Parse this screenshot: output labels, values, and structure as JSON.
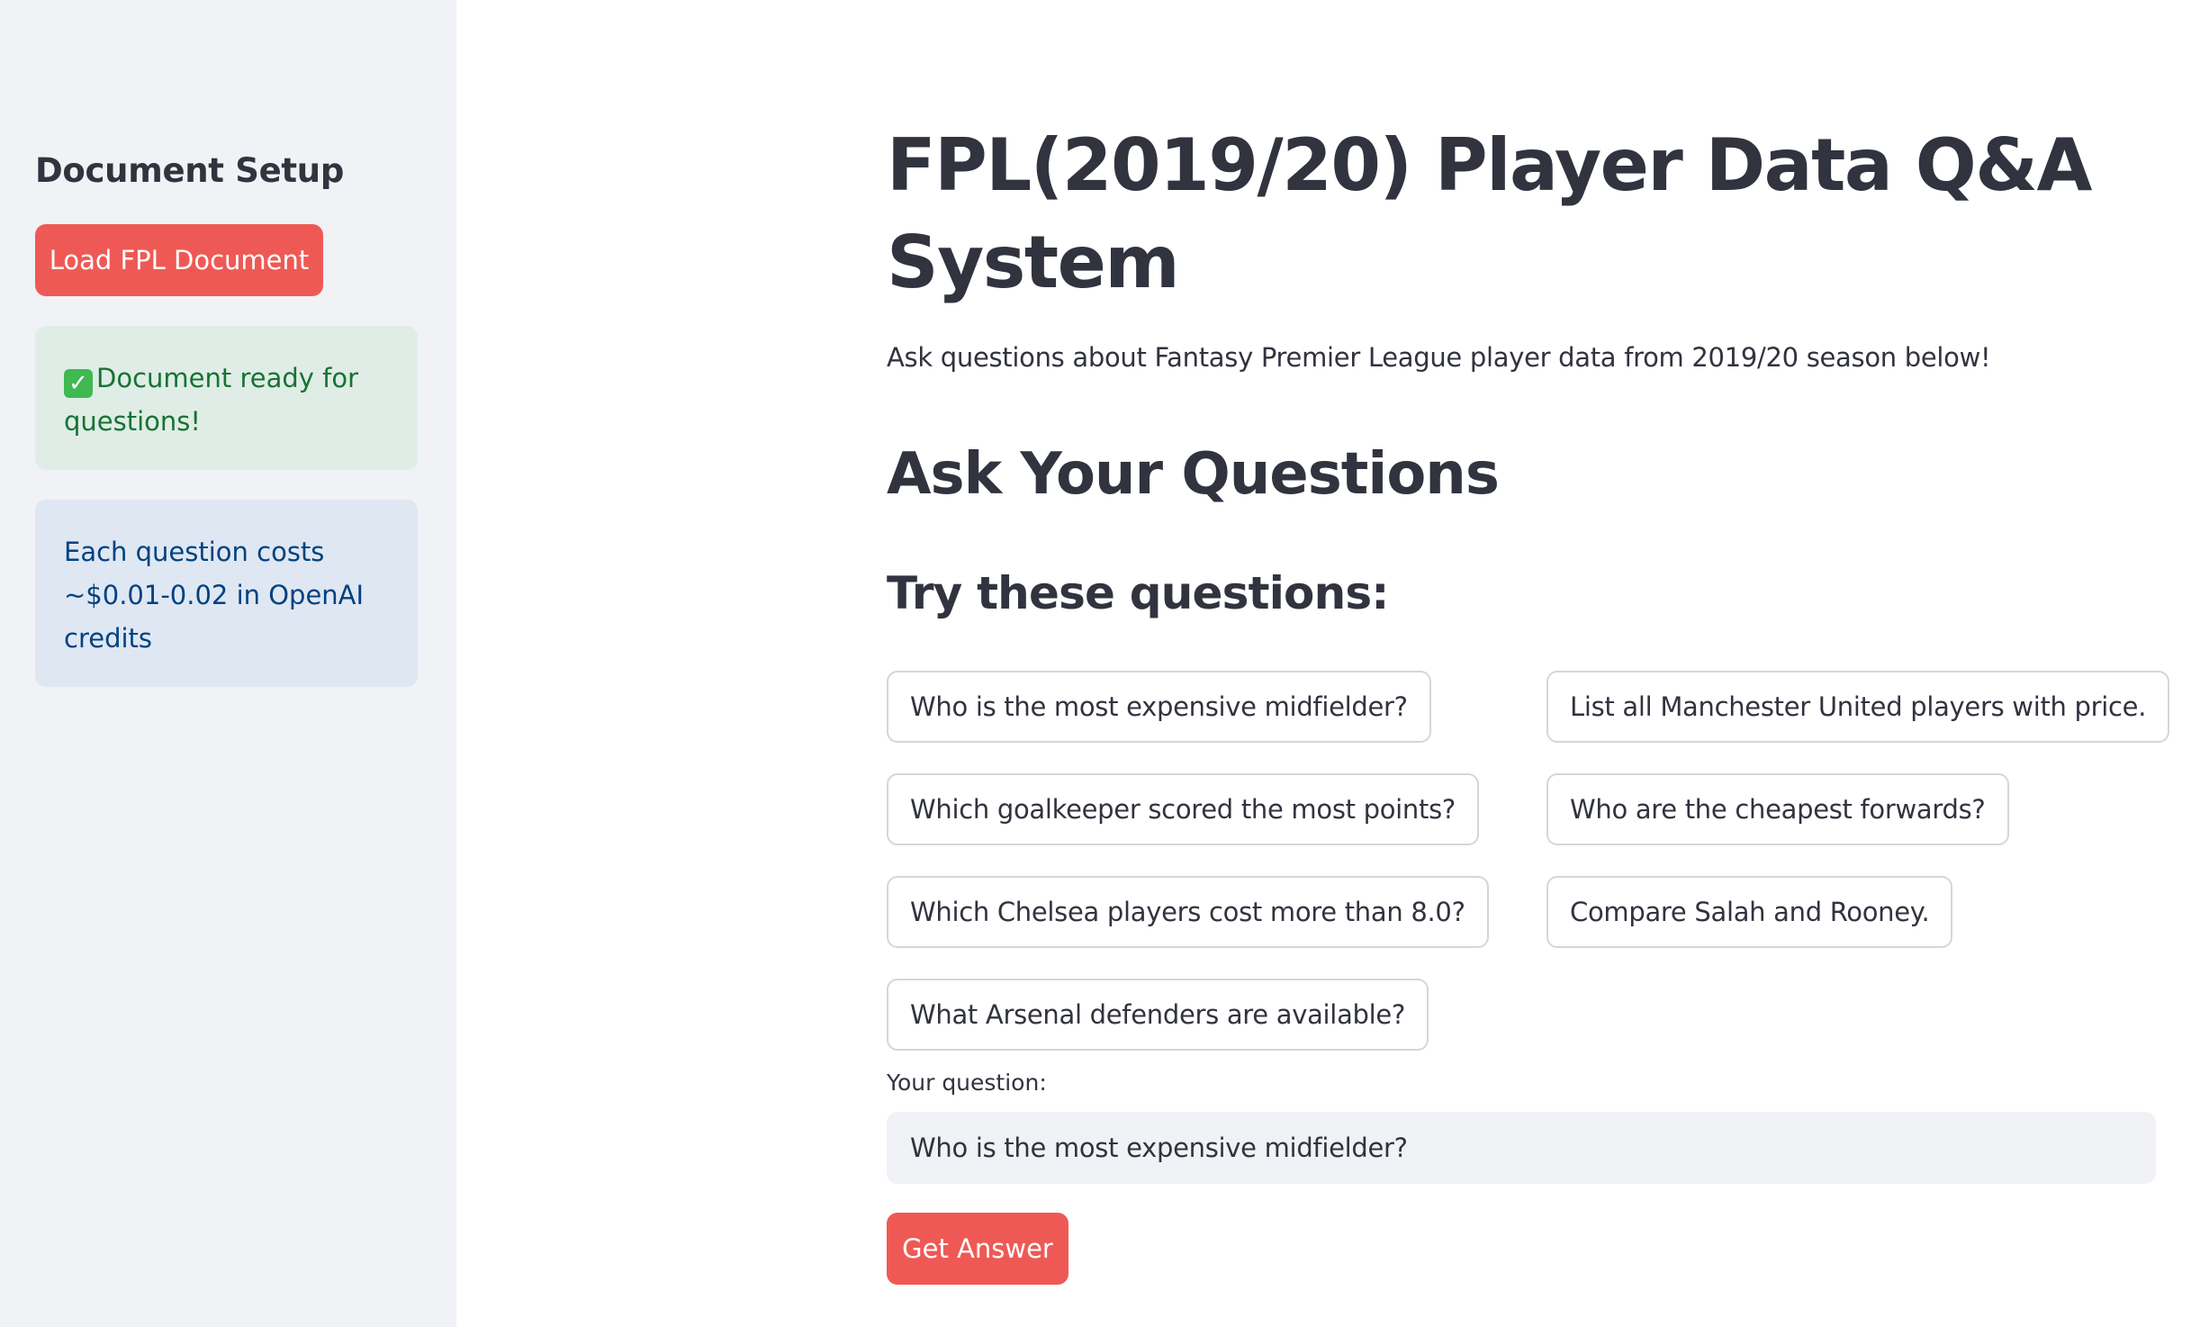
{
  "sidebar": {
    "heading": "Document Setup",
    "load_button": "Load FPL Document",
    "success_icon": "check-mark-icon",
    "success_message": "Document ready for questions!",
    "info_message": "Each question costs ~$0.01-0.02 in OpenAI credits"
  },
  "main": {
    "title": "FPL(2019/20) Player Data Q&A System",
    "subtitle": "Ask questions about Fantasy Premier League player data from 2019/20 season below!",
    "section_heading": "Ask Your Questions",
    "suggestions_heading": "Try these questions:",
    "suggestions": [
      "Who is the most expensive midfielder?",
      "List all Manchester United players with price.",
      "Which goalkeeper scored the most points?",
      "Who are the cheapest forwards?",
      "Which Chelsea players cost more than 8.0?",
      "Compare Salah and Rooney.",
      "What Arsenal defenders are available?"
    ],
    "question_label": "Your question:",
    "question_value": "Who is the most expensive midfielder?",
    "submit_button": "Get Answer"
  },
  "colors": {
    "primary": "#ef5955",
    "sidebar_bg": "#f0f2f6",
    "success_bg": "#dfede6",
    "success_text": "#177233",
    "info_bg": "#dfe7f2",
    "info_text": "#004280"
  }
}
